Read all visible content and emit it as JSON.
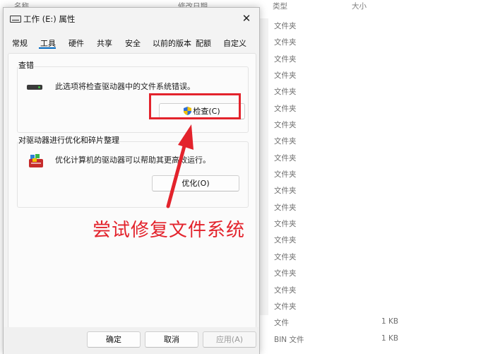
{
  "background": {
    "headers": {
      "name": "名称",
      "modified": "修改日期",
      "type": "类型",
      "size": "大小"
    },
    "rows": [
      {
        "type": "文件夹",
        "size": ""
      },
      {
        "type": "文件夹",
        "size": ""
      },
      {
        "type": "文件夹",
        "size": ""
      },
      {
        "type": "文件夹",
        "size": ""
      },
      {
        "type": "文件夹",
        "size": ""
      },
      {
        "type": "文件夹",
        "size": ""
      },
      {
        "type": "文件夹",
        "size": ""
      },
      {
        "type": "文件夹",
        "size": ""
      },
      {
        "type": "文件夹",
        "size": ""
      },
      {
        "type": "文件夹",
        "size": ""
      },
      {
        "type": "文件夹",
        "size": ""
      },
      {
        "type": "文件夹",
        "size": ""
      },
      {
        "type": "文件夹",
        "size": ""
      },
      {
        "type": "文件夹",
        "size": ""
      },
      {
        "type": "文件夹",
        "size": ""
      },
      {
        "type": "文件夹",
        "size": ""
      },
      {
        "type": "文件夹",
        "size": ""
      },
      {
        "type": "文件夹",
        "size": ""
      },
      {
        "type": "文件",
        "size": "1 KB"
      },
      {
        "type": "BIN 文件",
        "size": "1 KB"
      }
    ]
  },
  "dialog": {
    "title": "工作 (E:) 属性",
    "close_glyph": "✕",
    "tabs": [
      "常规",
      "工具",
      "硬件",
      "共享",
      "安全",
      "以前的版本",
      "配额",
      "自定义"
    ],
    "active_tab": "工具",
    "check": {
      "title": "查错",
      "description": "此选项将检查驱动器中的文件系统错误。",
      "button": "检查(C)"
    },
    "optimize": {
      "title": "对驱动器进行优化和碎片整理",
      "description": "优化计算机的驱动器可以帮助其更高效运行。",
      "button": "优化(O)"
    },
    "buttons": {
      "ok": "确定",
      "cancel": "取消",
      "apply": "应用(A)"
    }
  },
  "annotation": {
    "caption": "尝试修复文件系统",
    "color": "#e3232c"
  }
}
